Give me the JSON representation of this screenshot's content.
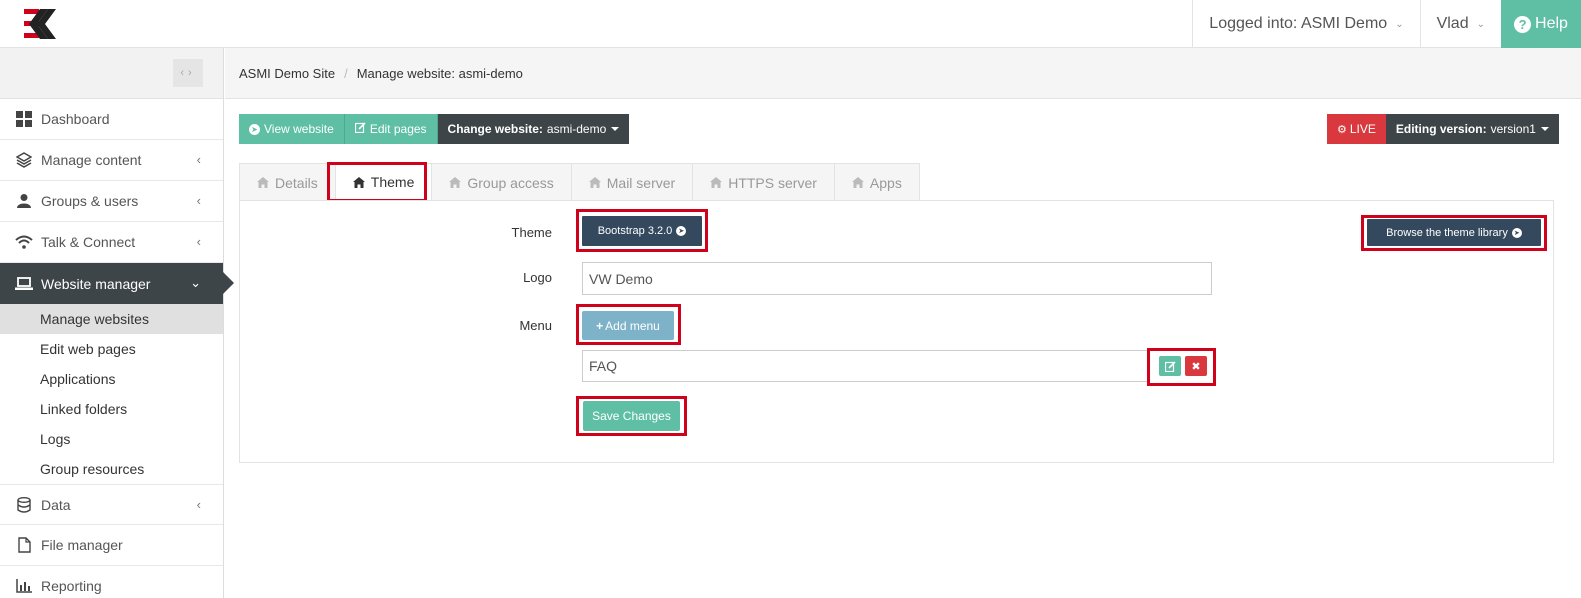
{
  "topbar": {
    "logged_into": "Logged into: ASMI Demo",
    "user": "Vlad",
    "help": "Help"
  },
  "sidebar": {
    "items": [
      {
        "label": "Dashboard",
        "icon": "grid-icon"
      },
      {
        "label": "Manage content",
        "icon": "layers-icon"
      },
      {
        "label": "Groups & users",
        "icon": "user-icon"
      },
      {
        "label": "Talk & Connect",
        "icon": "wifi-icon"
      },
      {
        "label": "Website manager",
        "icon": "laptop-icon"
      }
    ],
    "subitems": [
      "Manage websites",
      "Edit web pages",
      "Applications",
      "Linked folders",
      "Logs",
      "Group resources"
    ],
    "bottom_items": [
      {
        "label": "Data",
        "icon": "database-icon"
      },
      {
        "label": "File manager",
        "icon": "file-icon"
      },
      {
        "label": "Reporting",
        "icon": "bar-chart-icon"
      }
    ]
  },
  "breadcrumb": {
    "site": "ASMI Demo Site",
    "page": "Manage website: asmi-demo"
  },
  "toolbar": {
    "view_website": "View website",
    "edit_pages": "Edit pages",
    "change_website_label": "Change website:",
    "change_website_value": "asmi-demo",
    "live": "LIVE",
    "editing_version_label": "Editing version:",
    "editing_version_value": "version1"
  },
  "tabs": [
    "Details",
    "Theme",
    "Group access",
    "Mail server",
    "HTTPS server",
    "Apps"
  ],
  "form": {
    "theme_label": "Theme",
    "theme_button": "Bootstrap 3.2.0",
    "browse_button": "Browse the theme library",
    "logo_label": "Logo",
    "logo_value": "VW Demo",
    "menu_label": "Menu",
    "add_menu": "Add menu",
    "menu_item": "FAQ",
    "save": "Save Changes"
  },
  "colors": {
    "accent": "#5ebfa5",
    "dark": "#3e4548",
    "navy": "#34495e",
    "live_red": "#d9393e",
    "highlight": "#d0021b"
  }
}
